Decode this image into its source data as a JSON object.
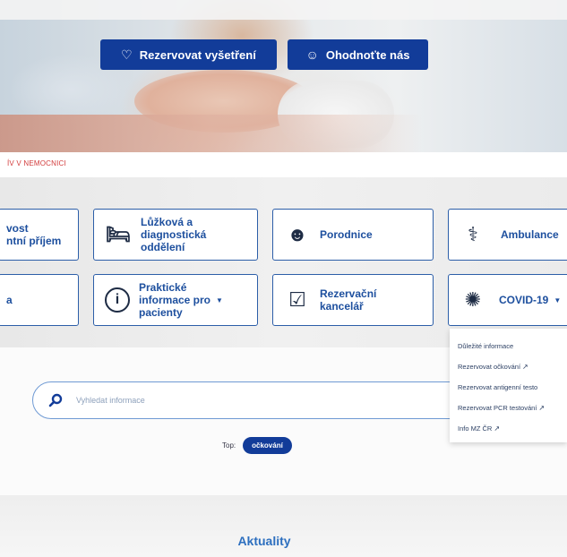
{
  "hero": {
    "buttons": [
      {
        "label": "Rezervovat vyšetření",
        "icon": "heart-icon"
      },
      {
        "label": "Ohodnoťte nás",
        "icon": "smile-icon"
      }
    ]
  },
  "breadcrumb": {
    "text": "ÍV V NEMOCNICI"
  },
  "tiles": [
    {
      "label": "vost\nntní příjem",
      "icon": "ambulance-icon"
    },
    {
      "label": "Lůžková a\ndiagnostická\noddělení",
      "icon": "bed-icon"
    },
    {
      "label": "Porodnice",
      "icon": "baby-icon"
    },
    {
      "label": "Ambulance",
      "icon": "doctor-icon"
    },
    {
      "label": "a",
      "icon": ""
    },
    {
      "label": "Praktické\ninformace pro\npacienty",
      "icon": "info-icon",
      "has_dropdown": true
    },
    {
      "label": "Rezervační\nkancelář",
      "icon": "calendar-check-icon"
    },
    {
      "label": "COVID-19",
      "icon": "virus-icon",
      "has_dropdown": true
    }
  ],
  "covid_dropdown": {
    "items": [
      {
        "label": "Důležité informace",
        "external": false
      },
      {
        "label": "Rezervovat očkování",
        "external": true
      },
      {
        "label": "Rezervovat antigenní testo",
        "external": false
      },
      {
        "label": "Rezervovat PCR testování",
        "external": true
      },
      {
        "label": "Info MZ ČR",
        "external": true
      }
    ]
  },
  "search": {
    "placeholder": "Vyhledat informace",
    "icon": "search-icon"
  },
  "top": {
    "label": "Top:",
    "chip": "očkování"
  },
  "news": {
    "title": "Aktuality"
  },
  "colors": {
    "primary": "#123c99",
    "tile_text": "#1d4f9e",
    "accent_red": "#d23b3b",
    "link_blue": "#2d6fbf"
  }
}
